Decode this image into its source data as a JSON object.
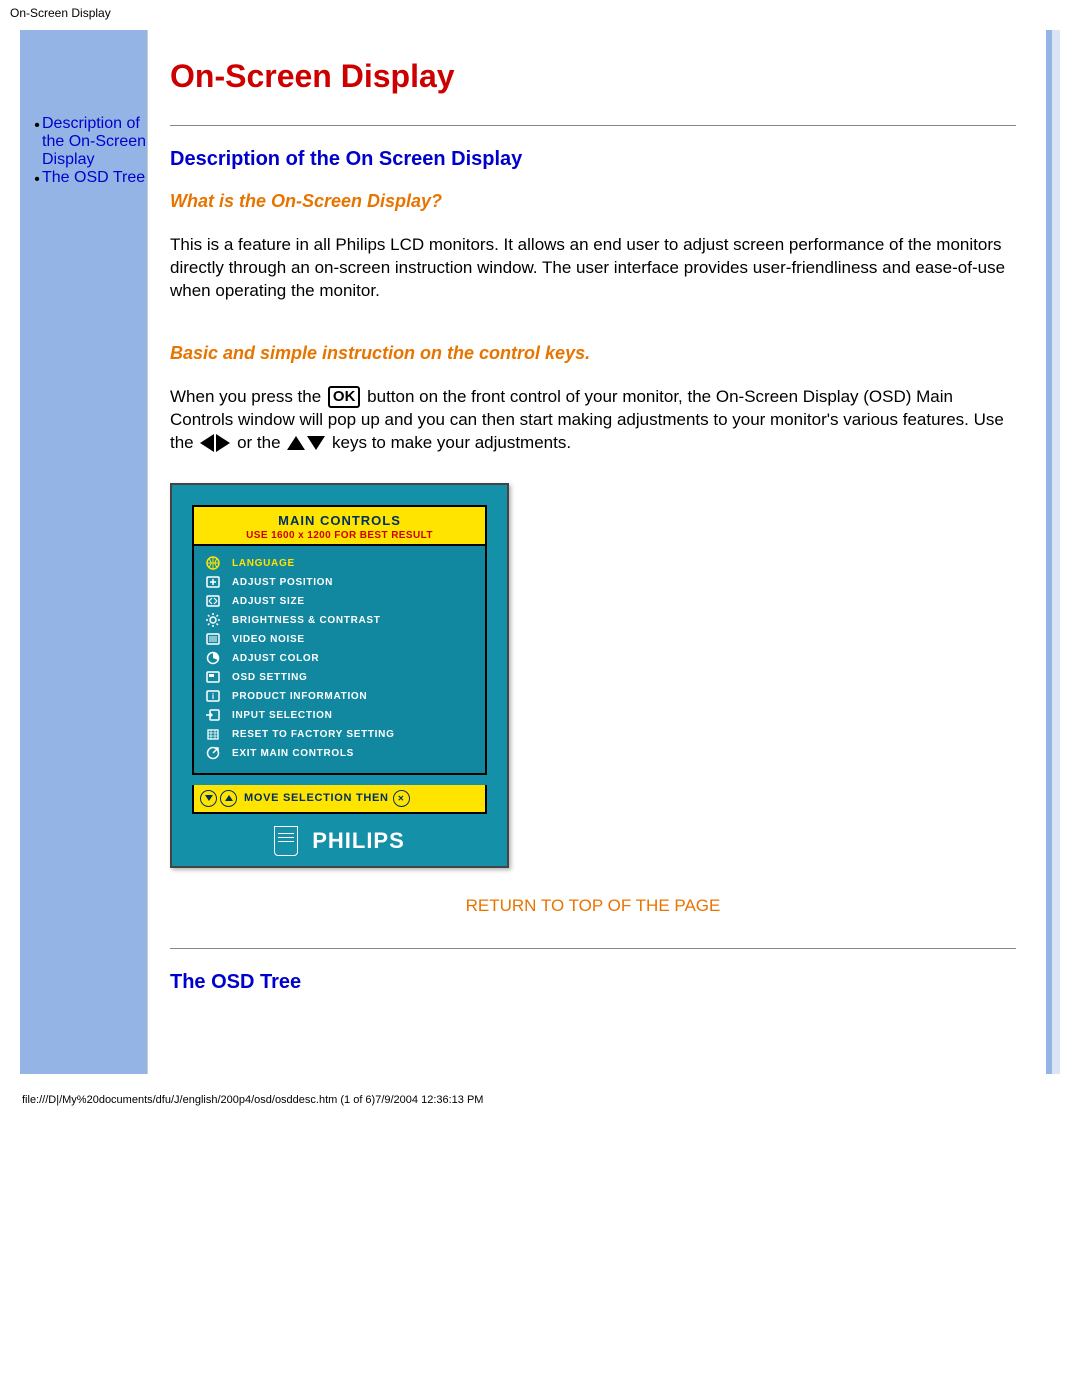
{
  "header_title": "On-Screen Display",
  "sidebar": {
    "items": [
      {
        "label": "Description of the On-Screen Display"
      },
      {
        "label": "The OSD Tree"
      }
    ]
  },
  "main": {
    "title": "On-Screen Display",
    "section1": {
      "heading": "Description of the On Screen Display",
      "sub1": "What is the On-Screen Display?",
      "para1": "This is a feature in all Philips LCD monitors. It allows an end user to adjust screen performance of the monitors directly through an on-screen instruction window. The user interface provides user-friendliness and ease-of-use when operating the monitor.",
      "sub2": "Basic and simple instruction on the control keys.",
      "para2_a": "When you press the ",
      "para2_b": " button on the front control of your monitor, the On-Screen Display (OSD) Main Controls window will pop up and you can then start making adjustments to your monitor's various features. Use the ",
      "para2_c": " or the ",
      "para2_d": " keys to make your adjustments.",
      "ok_label": "OK"
    },
    "osd": {
      "header_main": "MAIN CONTROLS",
      "header_sub": "USE 1600 x 1200 FOR BEST RESULT",
      "items": [
        {
          "label": "LANGUAGE",
          "active": true,
          "icon": "globe"
        },
        {
          "label": "ADJUST POSITION",
          "active": false,
          "icon": "pos"
        },
        {
          "label": "ADJUST SIZE",
          "active": false,
          "icon": "size"
        },
        {
          "label": "BRIGHTNESS & CONTRAST",
          "active": false,
          "icon": "sun"
        },
        {
          "label": "VIDEO NOISE",
          "active": false,
          "icon": "noise"
        },
        {
          "label": "ADJUST COLOR",
          "active": false,
          "icon": "color"
        },
        {
          "label": "OSD SETTING",
          "active": false,
          "icon": "osd"
        },
        {
          "label": "PRODUCT INFORMATION",
          "active": false,
          "icon": "info"
        },
        {
          "label": "INPUT SELECTION",
          "active": false,
          "icon": "input"
        },
        {
          "label": "RESET TO FACTORY SETTING",
          "active": false,
          "icon": "reset"
        },
        {
          "label": "EXIT MAIN CONTROLS",
          "active": false,
          "icon": "exit"
        }
      ],
      "footer_text": "MOVE SELECTION THEN",
      "brand": "PHILIPS"
    },
    "return_link": "RETURN TO TOP OF THE PAGE",
    "section2_heading": "The OSD Tree"
  },
  "footer_path": "file:///D|/My%20documents/dfu/J/english/200p4/osd/osddesc.htm (1 of 6)7/9/2004 12:36:13 PM"
}
